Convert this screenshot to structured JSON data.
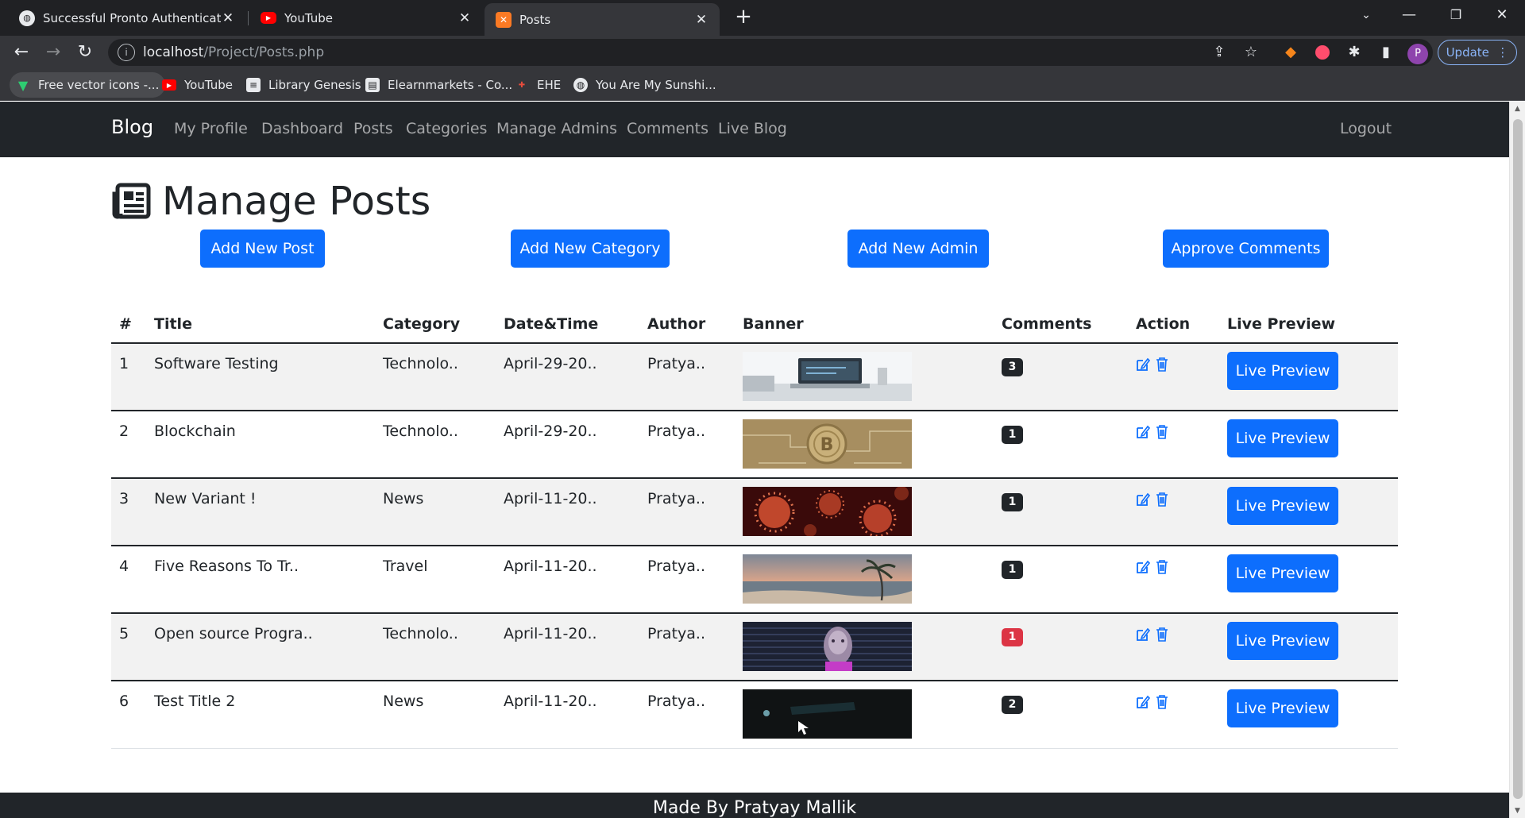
{
  "browser": {
    "tabs": [
      {
        "title": "Successful Pronto Authentication",
        "icon": "globe-icon",
        "active": false
      },
      {
        "title": "YouTube",
        "icon": "youtube-icon",
        "active": false
      },
      {
        "title": "Posts",
        "icon": "xampp-icon",
        "active": true
      }
    ],
    "url_host": "localhost",
    "url_path": "/Project/Posts.php",
    "update_label": "Update",
    "profile_initial": "P",
    "bookmarks": [
      {
        "label": "Free vector icons -...",
        "icon": "vector-icon"
      },
      {
        "label": "YouTube",
        "icon": "youtube-icon"
      },
      {
        "label": "Library Genesis",
        "icon": "book-icon"
      },
      {
        "label": "Elearnmarkets - Co...",
        "icon": "chart-icon"
      },
      {
        "label": "EHE",
        "icon": "ehe-icon"
      },
      {
        "label": "You Are My Sunshi...",
        "icon": "globe-icon"
      }
    ]
  },
  "site": {
    "brand": "Blog",
    "nav": [
      "My Profile",
      "Dashboard",
      "Posts",
      "Categories",
      "Manage Admins",
      "Comments",
      "Live Blog"
    ],
    "logout": "Logout"
  },
  "page": {
    "title": "Manage Posts",
    "title_icon": "newspaper-icon",
    "buttons": [
      "Add New Post",
      "Add New Category",
      "Add New Admin",
      "Approve Comments"
    ]
  },
  "table": {
    "headers": [
      "#",
      "Title",
      "Category",
      "Date&Time",
      "Author",
      "Banner",
      "Comments",
      "Action",
      "Live Preview"
    ],
    "rows": [
      {
        "num": "1",
        "title": "Software Testing",
        "category": "Technolo..",
        "date": "April-29-20..",
        "author": "Pratya..",
        "comments": "3",
        "badge_color": "#212529",
        "banner": "laptop-desk-image"
      },
      {
        "num": "2",
        "title": "Blockchain",
        "category": "Technolo..",
        "date": "April-29-20..",
        "author": "Pratya..",
        "comments": "1",
        "badge_color": "#212529",
        "banner": "bitcoin-image"
      },
      {
        "num": "3",
        "title": "New Variant !",
        "category": "News",
        "date": "April-11-20..",
        "author": "Pratya..",
        "comments": "1",
        "badge_color": "#212529",
        "banner": "virus-image"
      },
      {
        "num": "4",
        "title": "Five Reasons To Tr..",
        "category": "Travel",
        "date": "April-11-20..",
        "author": "Pratya..",
        "comments": "1",
        "badge_color": "#212529",
        "banner": "beach-image"
      },
      {
        "num": "5",
        "title": "Open source Progra..",
        "category": "Technolo..",
        "date": "April-11-20..",
        "author": "Pratya..",
        "comments": "1",
        "badge_color": "#dc3545",
        "banner": "digital-face-image"
      },
      {
        "num": "6",
        "title": "Test Title 2",
        "category": "News",
        "date": "April-11-20..",
        "author": "Pratya..",
        "comments": "2",
        "badge_color": "#212529",
        "banner": "security-image"
      }
    ],
    "live_preview_label": "Live Preview",
    "edit_icon": "edit-icon",
    "delete_icon": "trash-icon"
  },
  "footer": {
    "text": "Made By Pratyay Mallik"
  }
}
